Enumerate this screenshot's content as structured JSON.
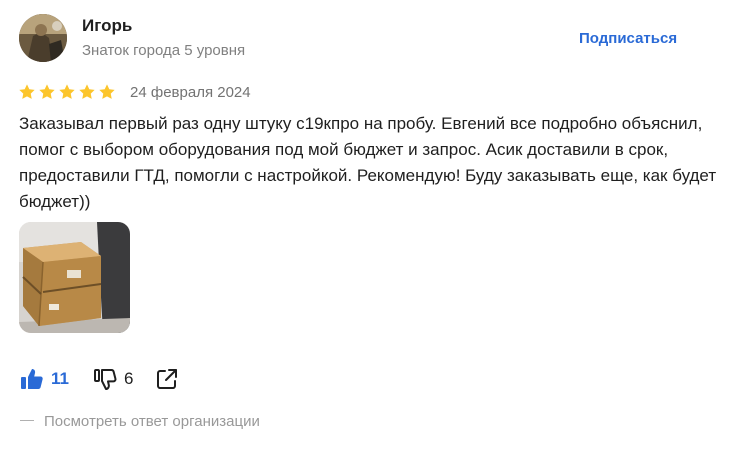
{
  "author": {
    "name": "Игорь",
    "level": "Знаток города 5 уровня",
    "subscribe_label": "Подписаться"
  },
  "review": {
    "rating": 5,
    "rating_max": 5,
    "date": "24 февраля 2024",
    "text": "Заказывал первый раз одну штуку с19кпро на пробу. Евгений все подробно объяснил, помог с выбором оборудования под мой бюджет и запрос. Асик доставили в срок, предоставили ГТД, помогли с настройкой. Рекомендую! Буду заказывать еще, как будет бюджет))",
    "photos_count": 1
  },
  "reactions": {
    "likes": "11",
    "dislikes": "6",
    "like_icon": "thumbs-up-icon",
    "dislike_icon": "thumbs-down-icon",
    "share_icon": "share-icon"
  },
  "org_reply_label": "Посмотреть ответ организации",
  "colors": {
    "star": "#fcc52c",
    "accent_blue": "#2a6ad6",
    "muted_text": "#808080"
  }
}
